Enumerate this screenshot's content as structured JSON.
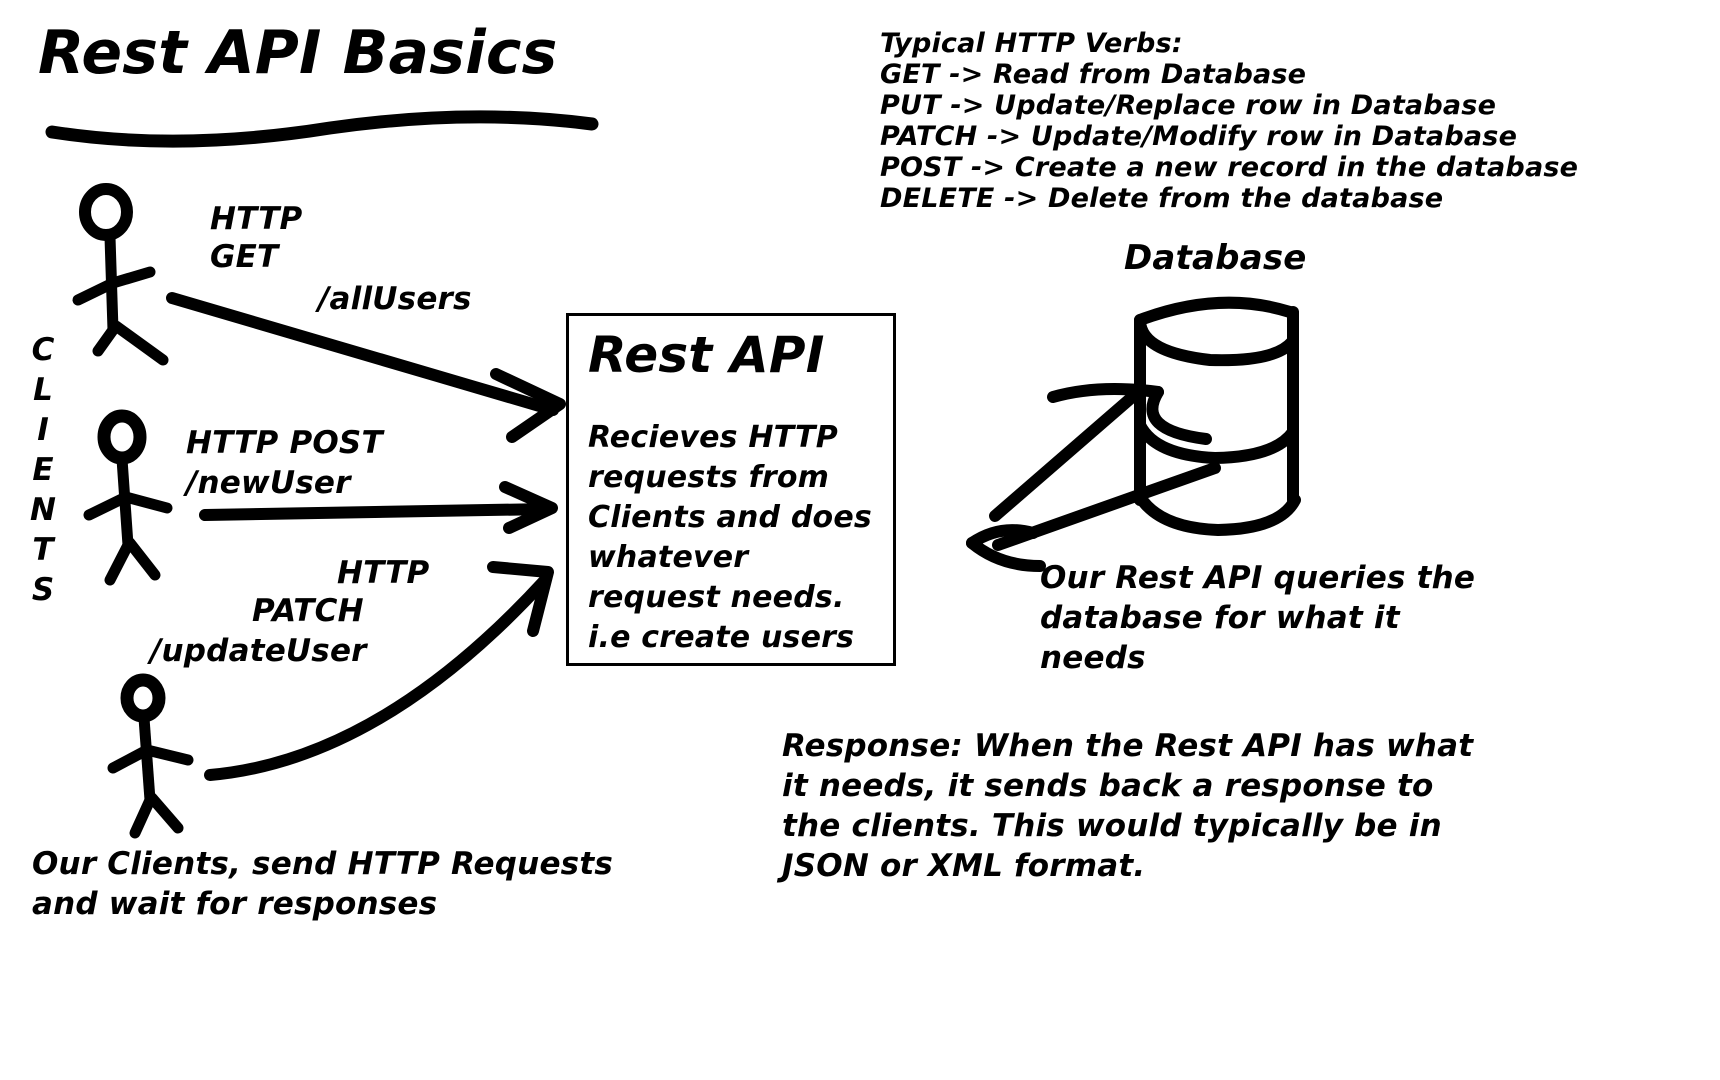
{
  "title": {
    "text": "Rest API Basics"
  },
  "http_verbs": {
    "heading": "Typical HTTP Verbs:",
    "lines": [
      "GET -> Read from Database",
      "PUT -> Update/Replace row in Database",
      "PATCH -> Update/Modify row in Database",
      "POST -> Create a new record in the database",
      "DELETE -> Delete from the database"
    ]
  },
  "clients": {
    "vertical_label": [
      "C",
      "L",
      "I",
      "E",
      "N",
      "T",
      "S"
    ],
    "caption_line1": "Our Clients, send HTTP Requests",
    "caption_line2": "and wait for responses"
  },
  "requests": {
    "get": {
      "verb_line1": "HTTP",
      "verb_line2": "GET",
      "path": "/allUsers"
    },
    "post": {
      "verb": "HTTP POST",
      "path": "/newUser"
    },
    "patch": {
      "verb_line1": "HTTP",
      "verb_line2": "PATCH",
      "path": "/updateUser"
    }
  },
  "api_box": {
    "title": "Rest API",
    "body": "Recieves HTTP requests from Clients and does whatever request needs. i.e create users"
  },
  "database": {
    "label": "Database",
    "caption": "Our Rest API queries the database for what it needs"
  },
  "response": {
    "text": "Response: When the Rest API has what it needs, it sends back a response to the clients. This would typically be in JSON or XML format."
  },
  "colors": {
    "ink": "#000000",
    "background": "#ffffff"
  }
}
